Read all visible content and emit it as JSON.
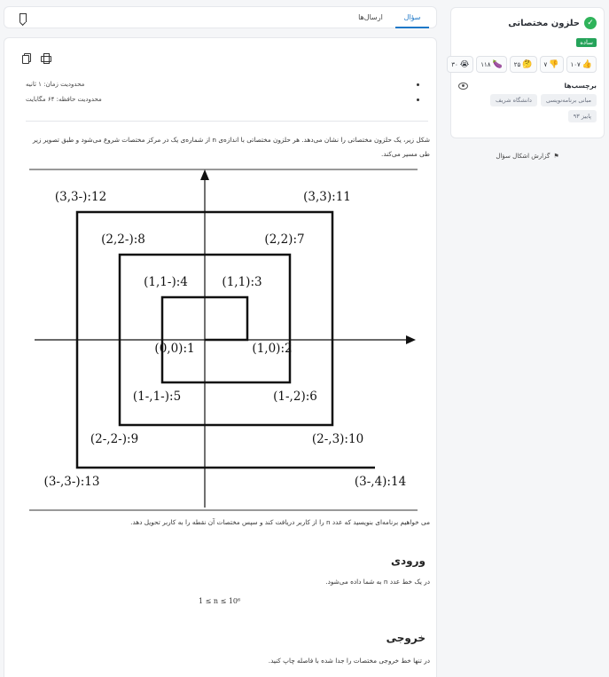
{
  "tabs": {
    "question": "سؤال",
    "submissions": "ارسال‌ها"
  },
  "sidebar": {
    "title": "حلزون مختصاتی",
    "difficulty": "ساده",
    "reactions": [
      {
        "icon": "thumbs-up-icon",
        "glyph": "👍",
        "count": "۱۰۷"
      },
      {
        "icon": "thumbs-down-icon",
        "glyph": "👎",
        "count": "۷"
      },
      {
        "icon": "thinking-face-icon",
        "glyph": "🤔",
        "count": "۲۵"
      },
      {
        "icon": "eggplant-icon",
        "glyph": "🍆",
        "count": "۱۱۸"
      },
      {
        "icon": "crying-face-icon",
        "glyph": "😭",
        "count": "۳۰"
      }
    ],
    "tags_label": "برچسب‌ها",
    "tags": [
      "مبانی برنامه‌نویسی",
      "دانشگاه شریف",
      "پاییز ۹۳"
    ],
    "report": "گزارش اشکال سؤال"
  },
  "limits": {
    "time": "محدودیت زمان: ۱ ثانیه",
    "memory": "محدودیت حافظه: ۶۴ مگابایت"
  },
  "statement": {
    "intro": "شکل زیر، یک حلزون مختصاتی را نشان می‌دهد. هر حلزون مختصاتی با اندازه‌ی n از شماره‌ی یک در مرکز مختصات شروع می‌شود و طبق تصویر زیر طی مسیر می‌کند.",
    "task": "می خواهیم برنامه‌ای بنویسید که عدد n را از کاربر دریافت کند و سپس مختصات آن نقطه را به کاربر تحویل دهد.",
    "input_heading": "ورودی",
    "input_text": "در یک خط عدد n به شما داده می‌شود.",
    "input_formula": "1 ≤ n ≤ 10⁶",
    "output_heading": "خروجی",
    "output_text": "در تنها خط خروجی مختصات را جدا شده با فاصله چاپ کنید."
  },
  "figure": {
    "points": [
      {
        "label": "1:(0,0)",
        "x": 0,
        "y": 0
      },
      {
        "label": "2:(1,0)",
        "x": 1,
        "y": 0
      },
      {
        "label": "3:(1,1)",
        "x": 1,
        "y": 1
      },
      {
        "label": "4:(-1,1)",
        "x": -1,
        "y": 1
      },
      {
        "label": "5:(-1,-1)",
        "x": -1,
        "y": -1
      },
      {
        "label": "6:(2,-1)",
        "x": 2,
        "y": -1
      },
      {
        "label": "7:(2,2)",
        "x": 2,
        "y": 2
      },
      {
        "label": "8:(-2,2)",
        "x": -2,
        "y": 2
      },
      {
        "label": "9:(-2,-2)",
        "x": -2,
        "y": -2
      },
      {
        "label": "10:(3,-2)",
        "x": 3,
        "y": -2
      },
      {
        "label": "11:(3,3)",
        "x": 3,
        "y": 3
      },
      {
        "label": "12:(-3,3)",
        "x": -3,
        "y": 3
      },
      {
        "label": "13:(-3,-3)",
        "x": -3,
        "y": -3
      },
      {
        "label": "14:(4,-3)",
        "x": 4,
        "y": -3
      }
    ]
  }
}
